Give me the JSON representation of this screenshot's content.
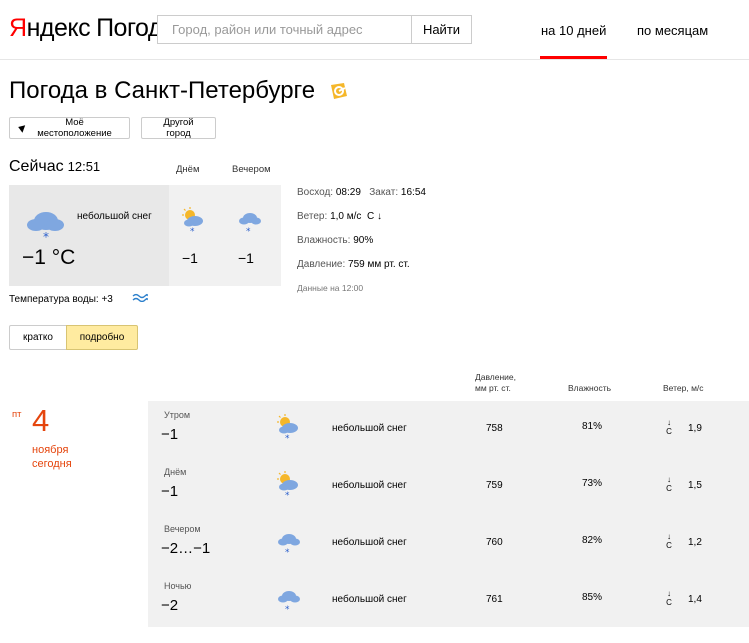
{
  "header": {
    "logo_brand_first": "Я",
    "logo_brand_rest": "ндекс",
    "logo_product": "Погода",
    "search_placeholder": "Город, район или точный адрес",
    "find_button": "Найти",
    "tabs": [
      {
        "label": "на 10 дней",
        "active": true
      },
      {
        "label": "по месяцам",
        "active": false
      }
    ]
  },
  "title": "Погода в Санкт-Петербурге",
  "location_buttons": {
    "my_location": "Моё местоположение",
    "other_city": "Другой город"
  },
  "now": {
    "label": "Сейчас",
    "time": "12:51",
    "day_label": "Днём",
    "evening_label": "Вечером",
    "condition": "небольшой снег",
    "temperature": "−1 °C",
    "day_temp": "−1",
    "evening_temp": "−1",
    "sunrise_label": "Восход:",
    "sunrise": "08:29",
    "sunset_label": "Закат:",
    "sunset": "16:54",
    "wind_label": "Ветер:",
    "wind": "1,0 м/с",
    "wind_dir": "С ↓",
    "humidity_label": "Влажность:",
    "humidity": "90%",
    "pressure_label": "Давление:",
    "pressure": "759 мм рт. ст.",
    "data_time": "Данные на 12:00",
    "water_temp": "Температура воды: +3",
    "icon": "cloud-snow-icon",
    "day_icon": "sun-cloud-snow-icon",
    "evening_icon": "cloud-snow-icon"
  },
  "view_toggle": {
    "short": "кратко",
    "detailed": "подробно",
    "selected": "подробно"
  },
  "table_headers": {
    "pressure_line1": "Давление,",
    "pressure_line2": "мм рт. ст.",
    "humidity": "Влажность",
    "wind": "Ветер, м/с"
  },
  "date": {
    "day_of_week": "пт",
    "day": "4",
    "month": "ноября",
    "relative": "сегодня"
  },
  "rows": [
    {
      "part": "Утром",
      "temp": "−1",
      "icon": "sun-cloud-snow-icon",
      "condition": "небольшой снег",
      "pressure": "758",
      "humidity": "81%",
      "wind_arrow": "↓",
      "wind_dir": "С",
      "wind_speed": "1,9"
    },
    {
      "part": "Днём",
      "temp": "−1",
      "icon": "sun-cloud-snow-icon",
      "condition": "небольшой снег",
      "pressure": "759",
      "humidity": "73%",
      "wind_arrow": "↓",
      "wind_dir": "С",
      "wind_speed": "1,5"
    },
    {
      "part": "Вечером",
      "temp": "−2…−1",
      "icon": "cloud-snow-icon",
      "condition": "небольшой снег",
      "pressure": "760",
      "humidity": "82%",
      "wind_arrow": "↓",
      "wind_dir": "С",
      "wind_speed": "1,2"
    },
    {
      "part": "Ночью",
      "temp": "−2",
      "icon": "cloud-snow-icon",
      "condition": "небольшой снег",
      "pressure": "761",
      "humidity": "85%",
      "wind_arrow": "↓",
      "wind_dir": "С",
      "wind_speed": "1,4"
    }
  ],
  "colors": {
    "brand_red": "#ff0000",
    "date_red": "#e5450d",
    "toggle_selected": "#ffeba0",
    "cloud": "#7fa7e0",
    "sun": "#f5b72a"
  }
}
